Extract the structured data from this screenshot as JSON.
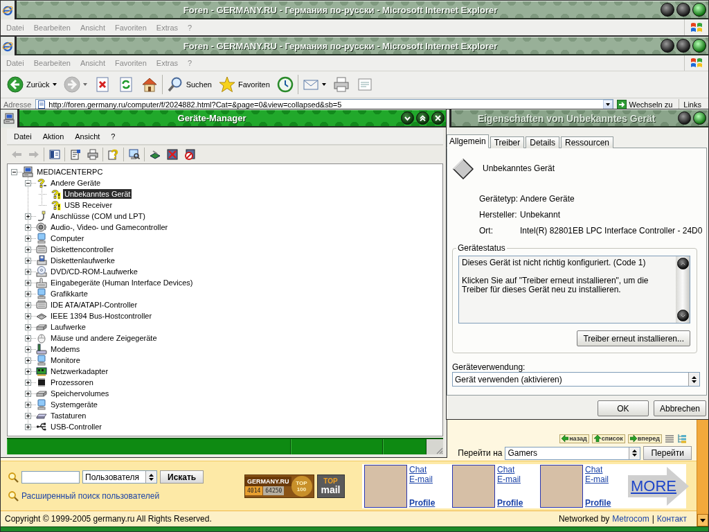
{
  "background_browser": {
    "title": "Foren - GERMANY.RU - Германия по-русски - Microsoft Internet Explorer",
    "menu": [
      "Datei",
      "Bearbeiten",
      "Ansicht",
      "Favoriten",
      "Extras",
      "?"
    ]
  },
  "browser": {
    "title": "Foren - GERMANY.RU - Германия по-русски - Microsoft Internet Explorer",
    "menu": [
      "Datei",
      "Bearbeiten",
      "Ansicht",
      "Favoriten",
      "Extras",
      "?"
    ],
    "toolbar": [
      {
        "buttons": [
          {
            "kind": "back",
            "label": "Zurück",
            "dropdown": true,
            "disabled": false
          },
          {
            "kind": "forward",
            "dropdown": true,
            "disabled": true
          },
          {
            "kind": "stop",
            "dropdown": false,
            "disabled": false
          },
          {
            "kind": "refresh",
            "dropdown": false,
            "disabled": false
          },
          {
            "kind": "home",
            "dropdown": false,
            "disabled": false
          }
        ]
      },
      {
        "buttons": [
          {
            "kind": "search",
            "label": "Suchen",
            "dropdown": false,
            "disabled": false
          },
          {
            "kind": "favorites",
            "label": "Favoriten",
            "dropdown": false,
            "disabled": false
          },
          {
            "kind": "history",
            "dropdown": false,
            "disabled": false
          }
        ]
      },
      {
        "buttons": [
          {
            "kind": "mail",
            "dropdown": true,
            "disabled": false
          },
          {
            "kind": "print",
            "dropdown": false,
            "disabled": false
          },
          {
            "kind": "edit",
            "dropdown": false,
            "disabled": false
          }
        ]
      }
    ],
    "address_bar": {
      "label": "Adresse",
      "url": "http://foren.germany.ru/computer/f/2024882.html?Cat=&page=0&view=collapsed&sb=5",
      "go_button": "Wechseln zu",
      "links": "Links"
    },
    "page": {
      "nav_buttons": [
        {
          "kind": "back",
          "label": "назад"
        },
        {
          "kind": "list",
          "label": "список"
        },
        {
          "kind": "forward",
          "label": "вперед"
        }
      ],
      "goto": {
        "label": "Перейти на",
        "value": "Gamers",
        "button": "Перейти"
      },
      "search": {
        "scope": "Пользователя",
        "button": "Искать",
        "advanced_link": "Расширенный поиск пользователей"
      },
      "counter": {
        "brand": "GERMANY.RU",
        "hits": "4014",
        "hosts": "64250",
        "rank": "TOP 100"
      },
      "top_mail": {
        "top": "TOP",
        "mail": "mail"
      },
      "profiles": [
        {
          "chat": "Chat",
          "email": "E-mail",
          "profile": "Profile"
        },
        {
          "chat": "Chat",
          "email": "E-mail",
          "profile": "Profile"
        },
        {
          "chat": "Chat",
          "email": "E-mail",
          "profile": "Profile"
        }
      ],
      "more": "MORE",
      "footer": {
        "copyright": "Copyright © 1999-2005 germany.ru All Rights Reserved.",
        "networked_by": "Networked by",
        "links": [
          "Metrocom",
          "Контакт"
        ],
        "separator": "|"
      }
    }
  },
  "device_manager": {
    "title": "Geräte-Manager",
    "menu": [
      "Datei",
      "Aktion",
      "Ansicht",
      "?"
    ],
    "toolbar": [
      {
        "buttons": [
          {
            "kind": "back",
            "disabled": true
          },
          {
            "kind": "forward",
            "disabled": true
          }
        ]
      },
      {
        "buttons": [
          {
            "kind": "console-tree",
            "disabled": false
          }
        ]
      },
      {
        "buttons": [
          {
            "kind": "properties",
            "disabled": false
          },
          {
            "kind": "print",
            "disabled": false
          }
        ]
      },
      {
        "buttons": [
          {
            "kind": "help",
            "disabled": false
          }
        ]
      },
      {
        "buttons": [
          {
            "kind": "scan",
            "disabled": false
          }
        ]
      },
      {
        "buttons": [
          {
            "kind": "update-driver",
            "disabled": false
          },
          {
            "kind": "uninstall",
            "disabled": false
          },
          {
            "kind": "disable",
            "disabled": false
          }
        ]
      }
    ],
    "tree": [
      {
        "label": "MEDIACENTERPC",
        "kind": "computer",
        "expanded": true,
        "selected": false,
        "children": [
          {
            "label": "Andere Geräte",
            "kind": "unknown",
            "expanded": true,
            "selected": false,
            "children": [
              {
                "label": "Unbekanntes Gerät",
                "kind": "unknown-device",
                "selected": true
              },
              {
                "label": "USB Receiver",
                "kind": "unknown-device",
                "selected": false
              }
            ]
          },
          {
            "label": "Anschlüsse (COM und LPT)",
            "kind": "port",
            "expanded": false,
            "selected": false
          },
          {
            "label": "Audio-, Video- und Gamecontroller",
            "kind": "audio",
            "expanded": false,
            "selected": false
          },
          {
            "label": "Computer",
            "kind": "monitor",
            "expanded": false,
            "selected": false
          },
          {
            "label": "Diskettencontroller",
            "kind": "controller",
            "expanded": false,
            "selected": false
          },
          {
            "label": "Diskettenlaufwerke",
            "kind": "floppy",
            "expanded": false,
            "selected": false
          },
          {
            "label": "DVD/CD-ROM-Laufwerke",
            "kind": "cdrom",
            "expanded": false,
            "selected": false
          },
          {
            "label": "Eingabegeräte (Human Interface Devices)",
            "kind": "hid",
            "expanded": false,
            "selected": false
          },
          {
            "label": "Grafikkarte",
            "kind": "monitor",
            "expanded": false,
            "selected": false
          },
          {
            "label": "IDE ATA/ATAPI-Controller",
            "kind": "controller",
            "expanded": false,
            "selected": false
          },
          {
            "label": "IEEE 1394 Bus-Hostcontroller",
            "kind": "firewire",
            "expanded": false,
            "selected": false
          },
          {
            "label": "Laufwerke",
            "kind": "disk",
            "expanded": false,
            "selected": false
          },
          {
            "label": "Mäuse und andere Zeigegeräte",
            "kind": "mouse",
            "expanded": false,
            "selected": false
          },
          {
            "label": "Modems",
            "kind": "modem",
            "expanded": false,
            "selected": false
          },
          {
            "label": "Monitore",
            "kind": "monitor",
            "expanded": false,
            "selected": false
          },
          {
            "label": "Netzwerkadapter",
            "kind": "network",
            "expanded": false,
            "selected": false
          },
          {
            "label": "Prozessoren",
            "kind": "cpu",
            "expanded": false,
            "selected": false
          },
          {
            "label": "Speichervolumes",
            "kind": "disk",
            "expanded": false,
            "selected": false
          },
          {
            "label": "Systemgeräte",
            "kind": "monitor",
            "expanded": false,
            "selected": false
          },
          {
            "label": "Tastaturen",
            "kind": "keyboard",
            "expanded": false,
            "selected": false
          },
          {
            "label": "USB-Controller",
            "kind": "usb",
            "expanded": false,
            "selected": false
          }
        ]
      }
    ]
  },
  "properties_dialog": {
    "title": "Eigenschaften von Unbekanntes Gerät",
    "tabs": [
      {
        "label": "Allgemein",
        "selected": true
      },
      {
        "label": "Treiber",
        "selected": false
      },
      {
        "label": "Details",
        "selected": false
      },
      {
        "label": "Ressourcen",
        "selected": false
      }
    ],
    "device_name": "Unbekanntes Gerät",
    "fields": [
      {
        "label": "Gerätetyp:",
        "value": "Andere Geräte"
      },
      {
        "label": "Hersteller:",
        "value": "Unbekannt"
      },
      {
        "label": "Ort:",
        "value": "Intel(R) 82801EB LPC Interface Controller - 24D0"
      }
    ],
    "status": {
      "title": "Gerätestatus",
      "paragraphs": [
        "Dieses Gerät ist nicht richtig konfiguriert. (Code 1)",
        "Klicken Sie auf \"Treiber erneut installieren\", um die Treiber für dieses Gerät neu zu installieren."
      ],
      "button": "Treiber erneut installieren..."
    },
    "usage": {
      "label": "Geräteverwendung:",
      "value": "Gerät verwenden (aktivieren)"
    },
    "buttons": [
      "OK",
      "Abbrechen"
    ]
  }
}
